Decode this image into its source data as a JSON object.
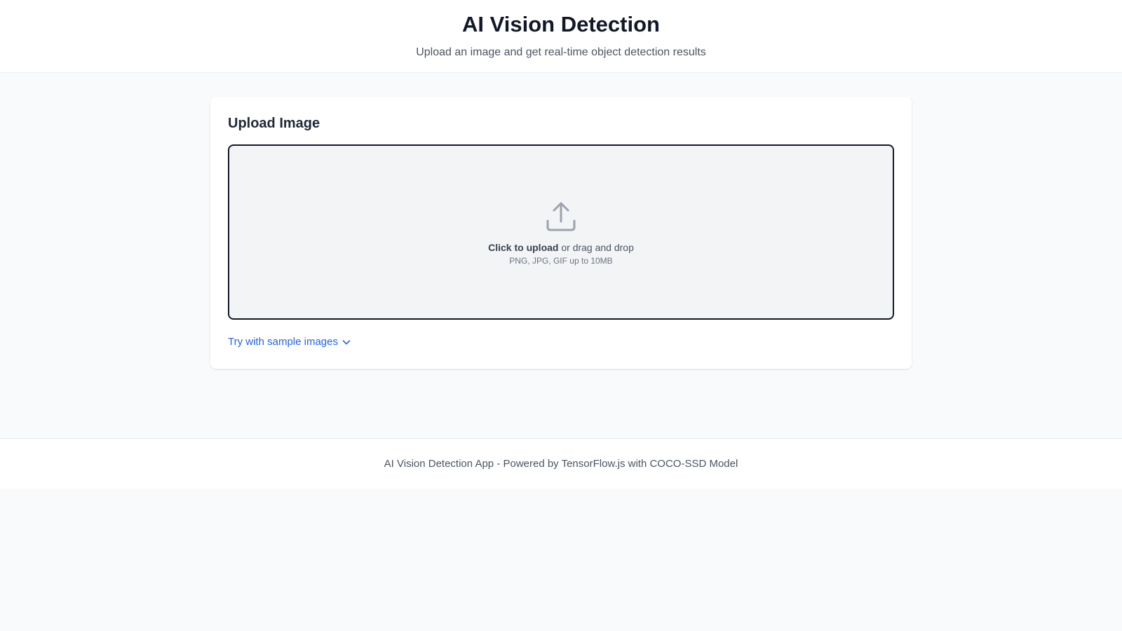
{
  "header": {
    "title": "AI Vision Detection",
    "subtitle": "Upload an image and get real-time object detection results"
  },
  "upload_card": {
    "title": "Upload Image",
    "dropzone": {
      "icon": "upload-icon",
      "click_text": "Click to upload",
      "drag_text": " or drag and drop",
      "hint": "PNG, JPG, GIF up to 10MB"
    },
    "sample_link": {
      "label": "Try with sample images",
      "icon": "chevron-down-icon"
    }
  },
  "footer": {
    "text": "AI Vision Detection App - Powered by TensorFlow.js with COCO-SSD Model"
  },
  "colors": {
    "background": "#f9fafb",
    "card": "#ffffff",
    "accent": "#2563eb",
    "dropzone_bg": "#f3f4f6",
    "icon": "#9ca3af"
  }
}
